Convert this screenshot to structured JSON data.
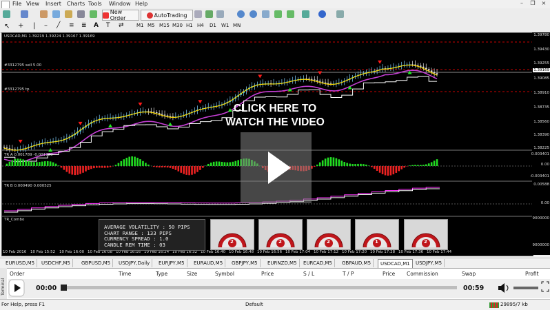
{
  "menu": {
    "items": [
      "File",
      "View",
      "Insert",
      "Charts",
      "Tools",
      "Window",
      "Help"
    ]
  },
  "toolbar": {
    "new_order": "New Order",
    "autotrading": "AutoTrading",
    "timeframes": [
      "M1",
      "M5",
      "M15",
      "M30",
      "H1",
      "H4",
      "D1",
      "W1",
      "MN"
    ]
  },
  "chart": {
    "header": "USDCAD,M1  1.39219 1.39224 1.39167 1.39169",
    "lines": {
      "sell_label": "#3312795 sell 5.00",
      "tp_label": "#3312795 tp"
    },
    "price_axis": [
      "1.39780",
      "1.39430",
      "1.39255",
      "1.39169",
      "1.39085",
      "1.38910",
      "1.38735",
      "1.38560",
      "1.38390",
      "1.38225"
    ],
    "current_price": "1.39169",
    "indicator1": {
      "label": "TR A 0.001789 -0.001789",
      "axis": [
        "0.003401",
        "0.00",
        "-0.003401"
      ]
    },
    "indicator2": {
      "label": "TR B 0.000490 0.000525",
      "axis": [
        "0.00588",
        "0.00"
      ]
    },
    "indicator3": {
      "label": "TR_Combo",
      "axis": [
        "9000000",
        "9000000"
      ]
    },
    "time_axis": [
      "10 Feb 2016",
      "10 Feb 15:52",
      "10 Feb 16:00",
      "10 Feb 16:08",
      "10 Feb 16:16",
      "10 Feb 16:24",
      "10 Feb 16:32",
      "10 Feb 16:40",
      "10 Feb 16:48",
      "10 Feb 16:56",
      "10 Feb 17:04",
      "10 Feb 17:12",
      "10 Feb 17:20",
      "10 Feb 17:28",
      "10 Feb 17:36",
      "10 Feb 17:44"
    ]
  },
  "infobox": {
    "lines": [
      "AVERAGE VOLATILITY : 50 PIPS",
      "CHART RANGE : 133 PIPS",
      "CURRENCY SPREAD : 1.0",
      "CANDLE REM TIME : 03"
    ]
  },
  "gauges": [
    "2",
    "2",
    "2",
    "1",
    "2"
  ],
  "video": {
    "title_line1": "CLICK HERE TO",
    "title_line2": "WATCH THE VIDEO",
    "time_current": "00:00",
    "time_total": "00:59",
    "progress": 0.0
  },
  "tabs": [
    "EURUSD,M5",
    "USDCHF,M5",
    "GBPUSD,M5",
    "USDJPY,Daily",
    "EURJPY,M5",
    "EURAUD,M5",
    "GBPJPY,M5",
    "EURNZD,M5",
    "EURCAD,M5",
    "GBPAUD,M5",
    "USDCAD,M1",
    "USDJPY,M5"
  ],
  "active_tab": "USDCAD,M1",
  "terminal": {
    "side_label": "Terminal",
    "columns": [
      "Order",
      "Time",
      "Type",
      "Size",
      "Symbol",
      "Price",
      "S / L",
      "T / P",
      "Price",
      "Commission",
      "Swap",
      "Profit"
    ]
  },
  "status": {
    "help": "For Help, press F1",
    "profile": "Default",
    "traffic": "29895/7 kb"
  },
  "colors": {
    "chart_bg": "#000000",
    "bull": "#00ff00",
    "bear": "#ff0000",
    "magenta": "#cc33cc",
    "yellow": "#ffdd00"
  }
}
